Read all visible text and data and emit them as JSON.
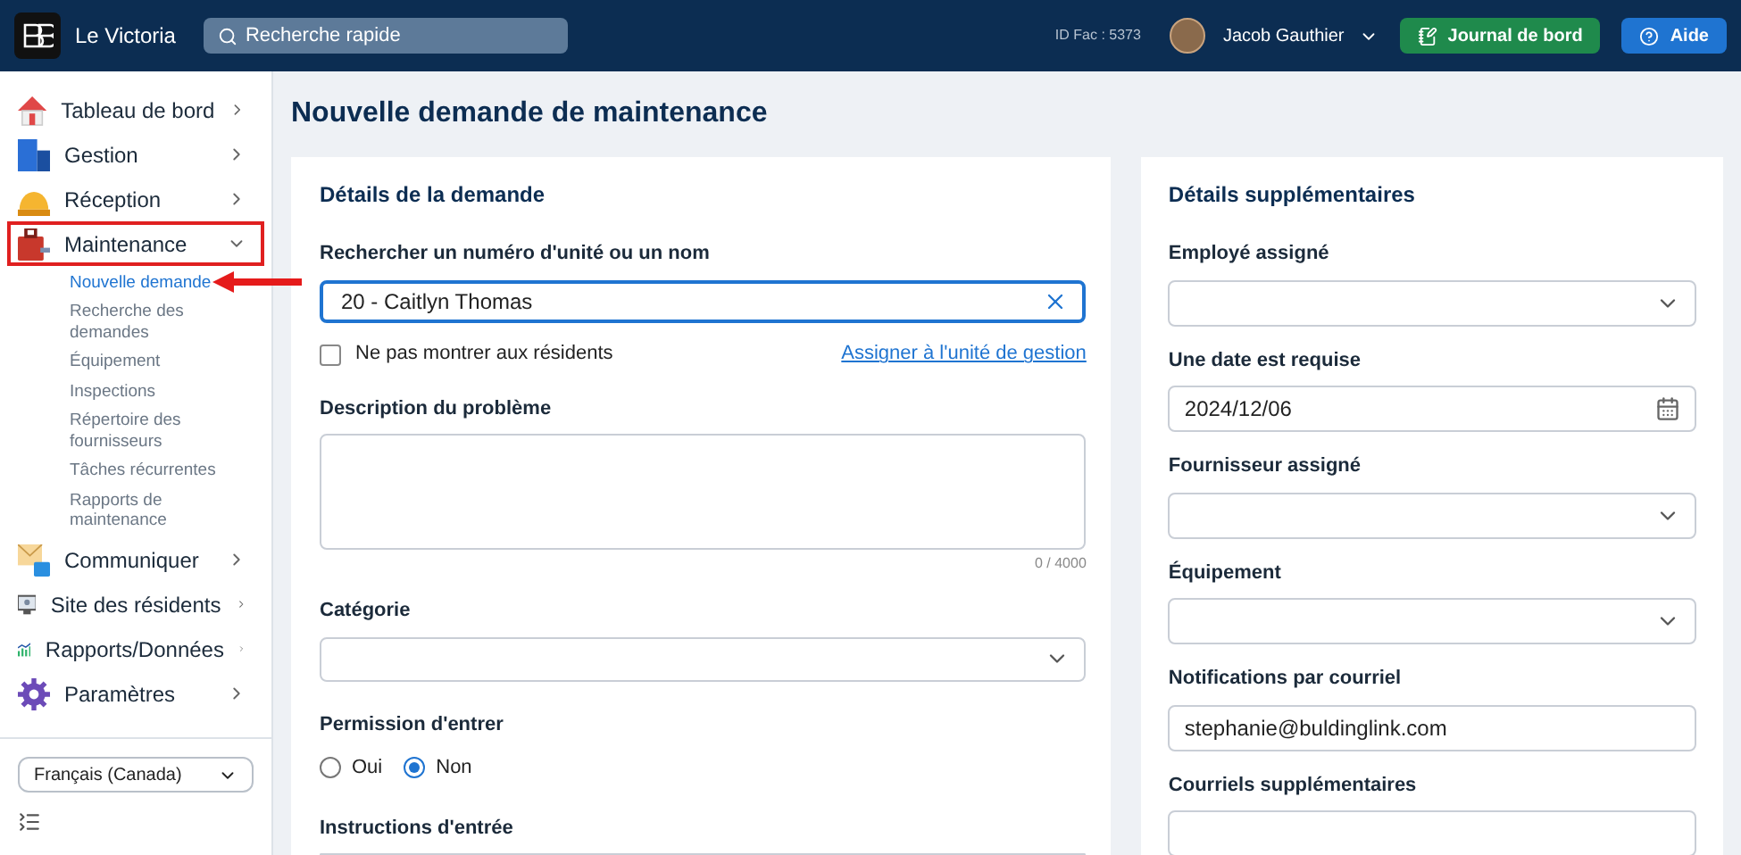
{
  "header": {
    "brand": "Le Victoria",
    "search": {
      "placeholder": "Recherche rapide"
    },
    "facility_id": "ID Fac : 5373",
    "user": "Jacob Gauthier",
    "buttons": [
      {
        "label": "Journal de bord",
        "kind": "logbook"
      },
      {
        "label": "Aide",
        "kind": "help"
      }
    ]
  },
  "sidebar": {
    "items": [
      {
        "label": "Tableau de bord",
        "expanded": false,
        "highlighted": false
      },
      {
        "label": "Gestion",
        "expanded": false,
        "highlighted": false
      },
      {
        "label": "Réception",
        "expanded": false,
        "highlighted": false
      },
      {
        "label": "Maintenance",
        "expanded": true,
        "highlighted": true,
        "children": [
          {
            "label": "Nouvelle demande",
            "selected": true
          },
          {
            "label": "Recherche des demandes",
            "selected": false
          },
          {
            "label": "Équipement",
            "selected": false
          },
          {
            "label": "Inspections",
            "selected": false
          },
          {
            "label": "Répertoire des fournisseurs",
            "selected": false
          },
          {
            "label": "Tâches récurrentes",
            "selected": false
          },
          {
            "label": "Rapports de maintenance",
            "selected": false
          }
        ]
      },
      {
        "label": "Communiquer",
        "expanded": false,
        "highlighted": false
      },
      {
        "label": "Site des résidents",
        "expanded": false,
        "highlighted": false
      },
      {
        "label": "Rapports/Données",
        "expanded": false,
        "highlighted": false
      },
      {
        "label": "Paramètres",
        "expanded": false,
        "highlighted": false
      }
    ],
    "language": "Français (Canada)"
  },
  "page_title": "Nouvelle demande de maintenance",
  "request_details": {
    "title": "Détails de la demande",
    "unit_search": {
      "label": "Rechercher un numéro d'unité ou un nom",
      "value": "20 - Caitlyn Thomas"
    },
    "hide_from_residents": {
      "label": "Ne pas montrer aux résidents",
      "checked": false
    },
    "assign_link": "Assigner à l'unité de gestion",
    "description": {
      "label": "Description du problème",
      "counter": "0 / 4000"
    },
    "category": {
      "label": "Catégorie"
    },
    "entry_permission": {
      "label": "Permission d'entrer",
      "options": [
        {
          "label": "Oui",
          "selected": false
        },
        {
          "label": "Non",
          "selected": true
        }
      ]
    },
    "entry_instructions": {
      "label": "Instructions d'entrée"
    }
  },
  "additional_details": {
    "title": "Détails supplémentaires",
    "fields": [
      {
        "label": "Employé assigné",
        "kind": "select"
      },
      {
        "label": "Une date est requise",
        "kind": "date",
        "value": "2024/12/06"
      },
      {
        "label": "Fournisseur assigné",
        "kind": "select"
      },
      {
        "label": "Équipement",
        "kind": "select"
      },
      {
        "label": "Notifications par courriel",
        "kind": "text",
        "value": "stephanie@buldinglink.com"
      },
      {
        "label": "Courriels supplémentaires",
        "kind": "text"
      }
    ]
  }
}
